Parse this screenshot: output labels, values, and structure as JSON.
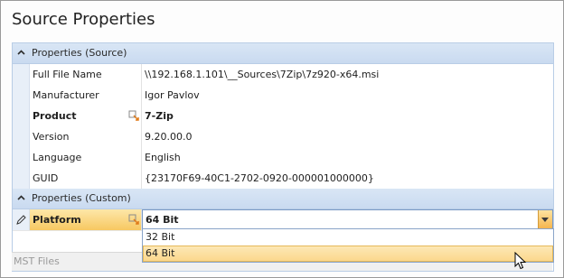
{
  "window": {
    "title": "Source Properties"
  },
  "categories": {
    "source": "Properties (Source)",
    "custom": "Properties (Custom)"
  },
  "source_rows": [
    {
      "name": "Full File Name",
      "value": "\\\\192.168.1.101\\__Sources\\7Zip\\7z920-x64.msi"
    },
    {
      "name": "Manufacturer",
      "value": "Igor Pavlov"
    },
    {
      "name": "Product",
      "value": "7-Zip"
    },
    {
      "name": "Version",
      "value": "9.20.00.0"
    },
    {
      "name": "Language",
      "value": "English"
    },
    {
      "name": "GUID",
      "value": "{23170F69-40C1-2702-0920-000001000000}"
    }
  ],
  "custom_rows": [
    {
      "name": "Platform",
      "value": "64 Bit"
    }
  ],
  "dropdown": {
    "options": [
      "32 Bit",
      "64 Bit"
    ],
    "highlighted": "64 Bit"
  },
  "footer": {
    "mst_label": "MST Files"
  },
  "colors": {
    "category_bg": "#c9daf0",
    "selected_row": "#f7c861",
    "highlight_option": "#fbd78a",
    "override_icon": "#e07b1a"
  },
  "icons": {
    "chevron": "chevron-up-icon",
    "override": "override-icon",
    "pencil": "pencil-icon",
    "dropdown_arrow": "chevron-down-icon",
    "cursor": "mouse-pointer-icon"
  }
}
